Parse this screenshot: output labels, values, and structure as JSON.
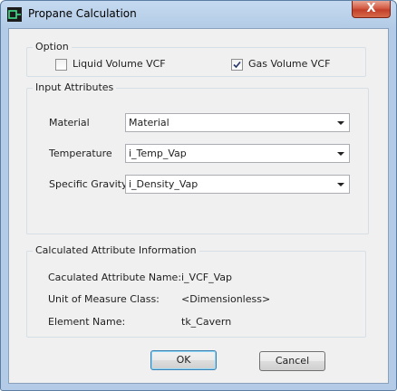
{
  "window": {
    "title": "Propane Calculation",
    "close_glyph": "X"
  },
  "option_group": {
    "label": "Option",
    "liquid": {
      "label": "Liquid Volume VCF",
      "checked": false
    },
    "gas": {
      "label": "Gas Volume VCF",
      "checked": true
    }
  },
  "input_group": {
    "label": "Input Attributes",
    "material": {
      "label": "Material",
      "value": "Material"
    },
    "temperature": {
      "label": "Temperature",
      "value": "i_Temp_Vap"
    },
    "gravity": {
      "label": "Specific Gravity",
      "value": "i_Density_Vap"
    }
  },
  "calc_group": {
    "label": "Calculated Attribute Information",
    "attr_name": {
      "label": "Caculated Attribute Name:",
      "value": "i_VCF_Vap"
    },
    "uom": {
      "label": "Unit of Measure Class:",
      "value": "<Dimensionless>"
    },
    "element": {
      "label": "Element Name:",
      "value": "tk_Cavern"
    }
  },
  "buttons": {
    "ok": "OK",
    "cancel": "Cancel"
  }
}
